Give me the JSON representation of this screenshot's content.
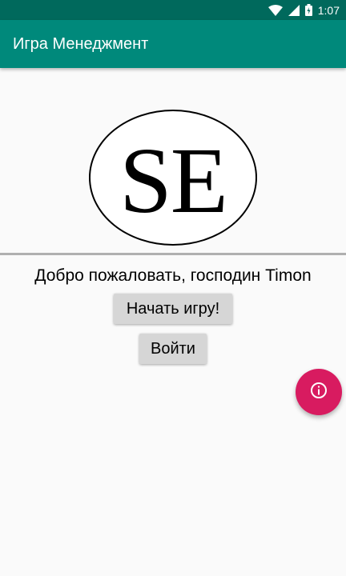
{
  "status_bar": {
    "time": "1:07",
    "icons": [
      "wifi-icon",
      "cell-signal-icon",
      "battery-icon"
    ]
  },
  "app_bar": {
    "title": "Игра Менеджмент",
    "color": "#00897b"
  },
  "logo": {
    "text": "SE"
  },
  "main": {
    "welcome_text": "Добро пожаловать, господин Timon",
    "start_button_label": "Начать игру!",
    "login_button_label": "Войти"
  },
  "fab": {
    "icon": "info-icon",
    "color": "#d81b60"
  }
}
